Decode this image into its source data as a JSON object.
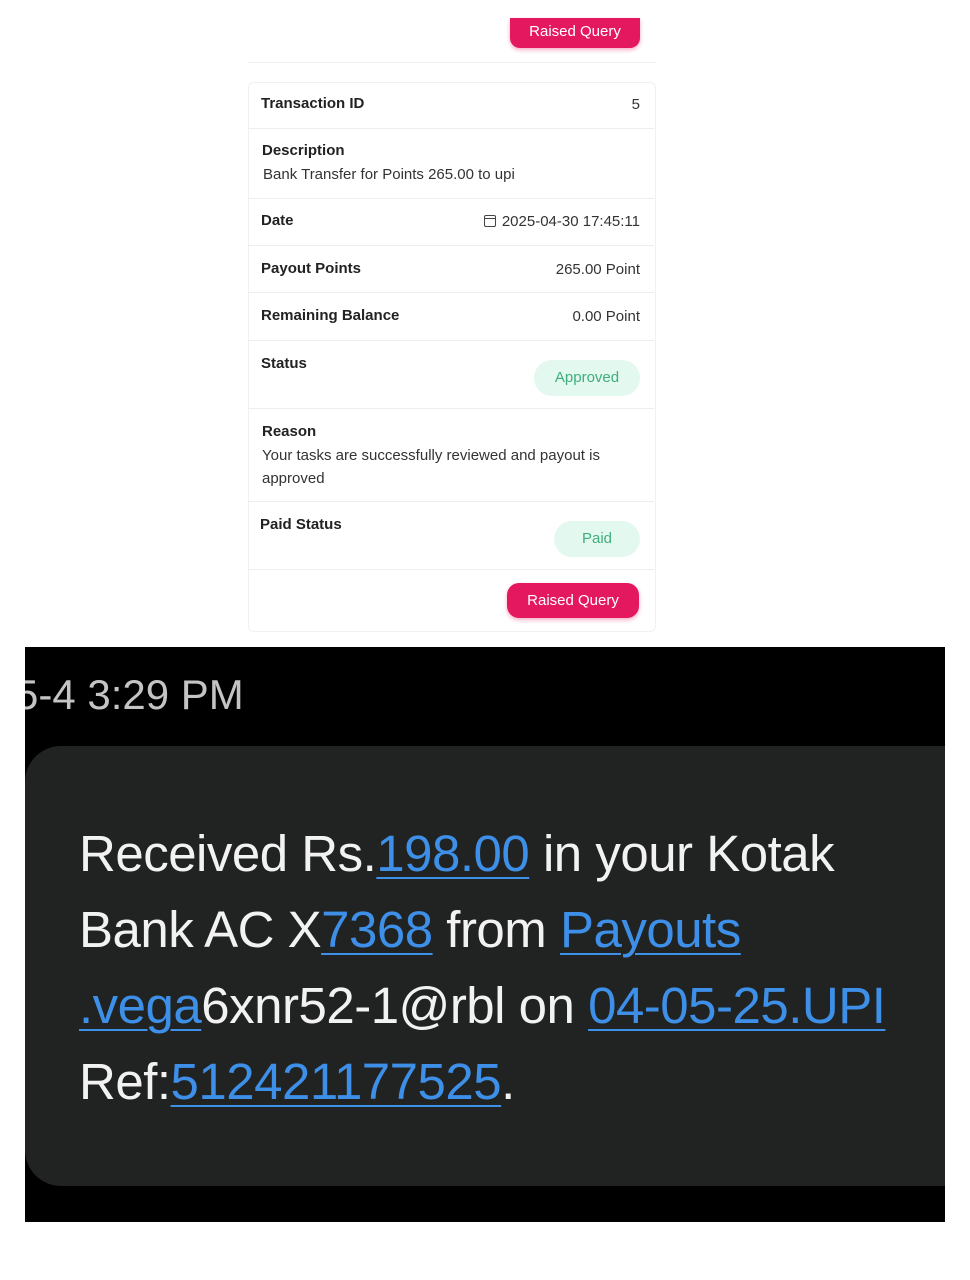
{
  "query_button_label": "Raised Query",
  "transaction": {
    "id_label": "Transaction ID",
    "id_value": "5",
    "description_label": "Description",
    "description_value": "Bank Transfer for Points 265.00 to upi",
    "date_label": "Date",
    "date_value": "2025-04-30 17:45:11",
    "date_icon": "calendar-icon",
    "payout_label": "Payout Points",
    "payout_value": "265.00 Point",
    "balance_label": "Remaining Balance",
    "balance_value": "0.00 Point",
    "status_label": "Status",
    "status_value": "Approved",
    "reason_label": "Reason",
    "reason_value": "Your tasks are successfully reviewed and payout is approved",
    "paid_status_label": "Paid Status",
    "paid_status_value": "Paid"
  },
  "colors": {
    "accent": "#e4185e",
    "status_bg": "#e3f8ee",
    "status_text": "#3fae7c",
    "sms_bg": "#212322",
    "link": "#3d8fe8"
  },
  "sms": {
    "timestamp": "5-4 3:29 PM",
    "line1_pre": "Received Rs.",
    "amount": "198.00",
    "line1_post": " in your Kotak",
    "line2_pre": "Bank AC X",
    "account": "7368",
    "line2_mid": " from ",
    "payee_part1": "Payouts",
    "payee_part2": ".vega",
    "line3_mid": "6xnr52-1@rbl on ",
    "date_ref": "04-05-25.UPI",
    "line4_pre": "Ref:",
    "ref_number": "512421177525",
    "line4_post": "."
  }
}
